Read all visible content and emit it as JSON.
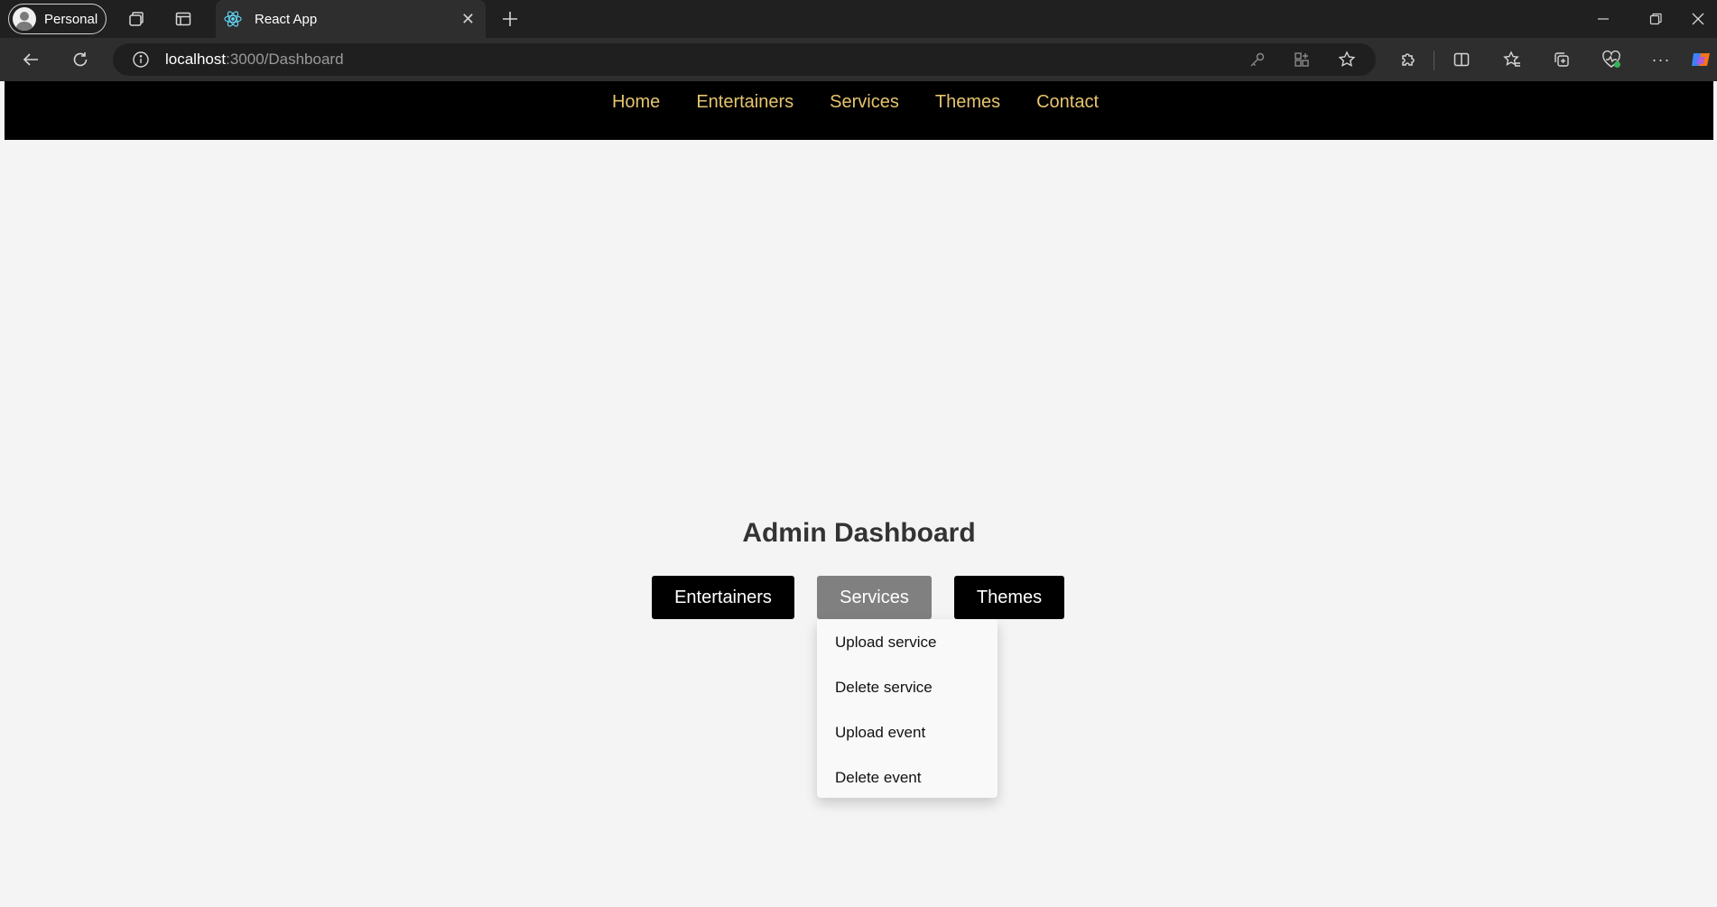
{
  "browser": {
    "profile_label": "Personal",
    "tab_title": "React App",
    "url_host": "localhost",
    "url_path": ":3000/Dashboard",
    "icons": [
      "tab-actions-icon",
      "vertical-tabs-icon",
      "react-icon",
      "close-icon",
      "new-tab-icon",
      "minimize-icon",
      "restore-icon",
      "window-close-icon",
      "back-icon",
      "refresh-icon",
      "site-info-icon",
      "key-icon",
      "apps-icon",
      "favorite-star-icon",
      "extensions-icon",
      "split-screen-icon",
      "favorites-icon",
      "collections-icon",
      "browser-essentials-icon",
      "more-icon",
      "copilot-icon"
    ]
  },
  "nav": {
    "items": [
      "Home",
      "Entertainers",
      "Services",
      "Themes",
      "Contact"
    ],
    "color": "#e6c46d"
  },
  "dashboard": {
    "title": "Admin Dashboard",
    "buttons": [
      {
        "label": "Entertainers",
        "active": false
      },
      {
        "label": "Services",
        "active": true
      },
      {
        "label": "Themes",
        "active": false
      }
    ],
    "dropdown": [
      "Upload service",
      "Delete service",
      "Upload event",
      "Delete event"
    ]
  }
}
